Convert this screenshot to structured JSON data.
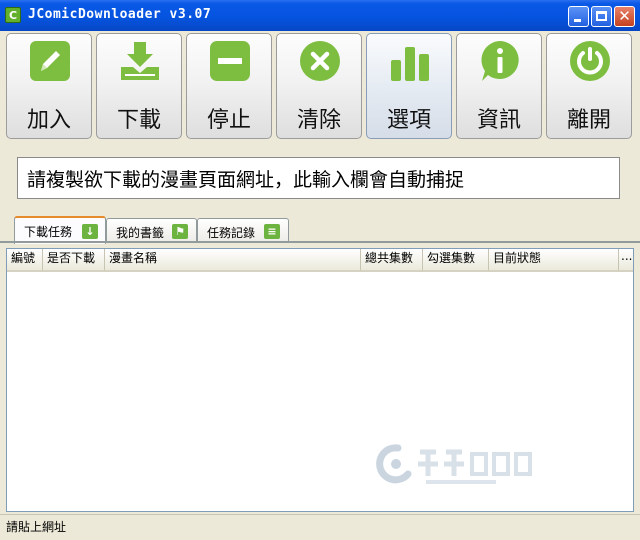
{
  "window": {
    "title": "JComicDownloader  v3.07",
    "app_icon_letter": "C"
  },
  "toolbar": {
    "buttons": [
      {
        "label": "加入",
        "icon": "pencil-icon"
      },
      {
        "label": "下載",
        "icon": "download-icon"
      },
      {
        "label": "停止",
        "icon": "stop-icon"
      },
      {
        "label": "清除",
        "icon": "clear-x-icon"
      },
      {
        "label": "選項",
        "icon": "bar-chart-icon"
      },
      {
        "label": "資訊",
        "icon": "info-icon"
      },
      {
        "label": "離開",
        "icon": "power-icon"
      }
    ]
  },
  "url_input": {
    "value": "請複製欲下載的漫畫頁面網址，此輸入欄會自動捕捉"
  },
  "tabs": [
    {
      "label": "下載任務",
      "icon": "down-arrow-icon",
      "active": true
    },
    {
      "label": "我的書籤",
      "icon": "flag-icon",
      "active": false
    },
    {
      "label": "任務記錄",
      "icon": "document-icon",
      "active": false
    }
  ],
  "table": {
    "columns": [
      "編號",
      "是否下載",
      "漫畫名稱",
      "總共集數",
      "勾選集數",
      "目前狀態",
      "..."
    ],
    "rows": []
  },
  "statusbar": {
    "text": "請貼上網址"
  },
  "colors": {
    "icon_green": "#7DBE41",
    "title_blue": "#0554E0",
    "tab_accent": "#E68B2C"
  }
}
